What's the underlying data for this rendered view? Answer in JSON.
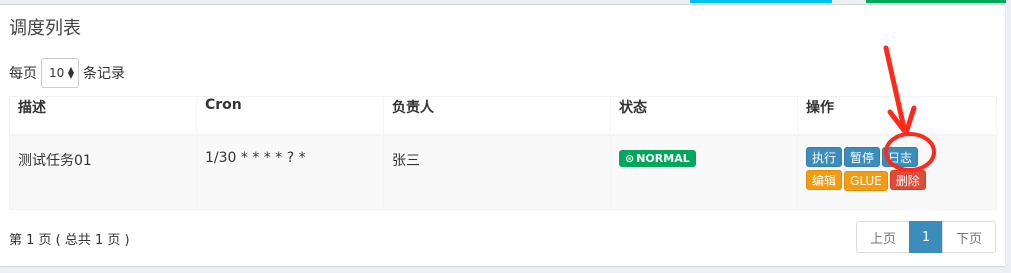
{
  "header": {
    "title": "调度列表"
  },
  "length": {
    "prefix": "每页",
    "value": "10",
    "suffix": "条记录"
  },
  "table": {
    "columns": [
      "描述",
      "Cron",
      "负责人",
      "状态",
      "操作"
    ],
    "rows": [
      {
        "desc": "测试任务01",
        "cron": "1/30 * * * * ? *",
        "owner": "张三",
        "status": "NORMAL",
        "actions": {
          "run": "执行",
          "pause": "暂停",
          "log": "日志",
          "edit": "编辑",
          "glue": "GLUE",
          "delete": "删除"
        }
      }
    ]
  },
  "footer": {
    "info": "第 1 页 ( 总共 1 页 )",
    "prev": "上页",
    "current": "1",
    "next": "下页"
  },
  "colors": {
    "primary": "#3c8dbc",
    "success": "#00a65a",
    "warning": "#f39c12",
    "danger": "#dd4b39",
    "annotation": "#ff2a1a"
  }
}
